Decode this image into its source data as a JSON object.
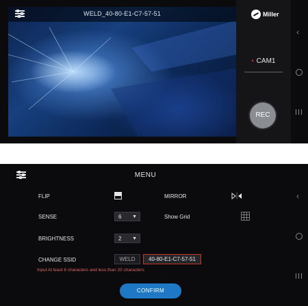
{
  "camera": {
    "stream_title": "WELD_40-80-E1-C7-57-51",
    "logo_text": "Miller",
    "cam_label": "CAM1",
    "rec_label": "REC"
  },
  "menu": {
    "title": "MENU",
    "flip_label": "FLIP",
    "mirror_label": "MIRROR",
    "sense_label": "SENSE",
    "sense_value": "6",
    "show_grid_label": "Show Grid",
    "brightness_label": "BRIGHTNESS",
    "brightness_value": "2",
    "change_ssid_label": "CHANGE SSID",
    "ssid_prefix": "WELD",
    "ssid_value": "40-80-E1-C7-57-51",
    "ssid_hint": "Input At least 8 characters and less than 20 characters",
    "confirm_label": "CONFIRM"
  },
  "icons": {
    "settings": "sliders-icon",
    "flip": "flip-icon",
    "mirror": "mirror-icon",
    "grid": "grid-icon",
    "dropdown": "caret-down-icon",
    "nav_back": "back-icon",
    "nav_home": "home-icon",
    "nav_recent": "recent-apps-icon"
  },
  "colors": {
    "accent_blue": "#1f78c6",
    "error_red": "#e06565",
    "background": "#0b0b0d"
  }
}
